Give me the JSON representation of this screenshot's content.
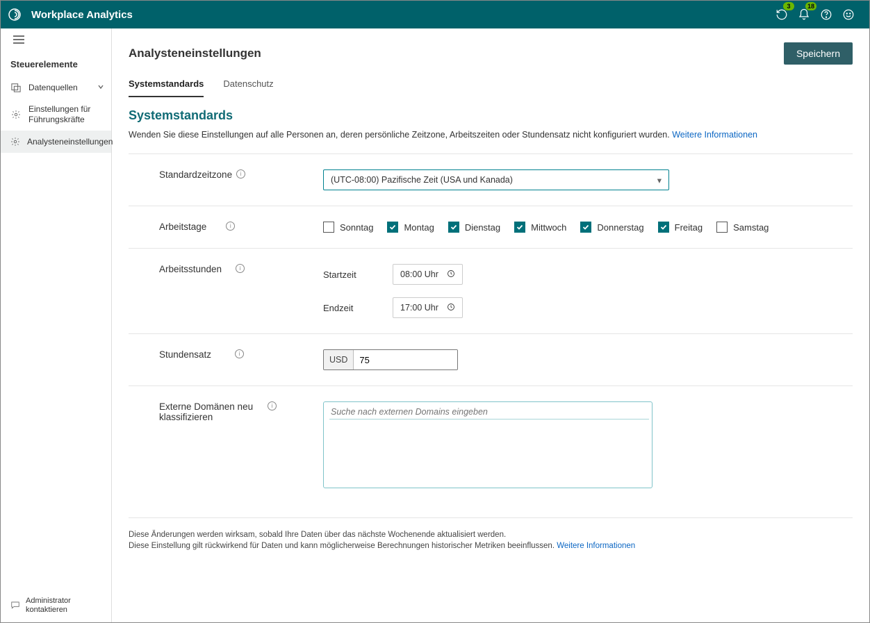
{
  "header": {
    "app_title": "Workplace Analytics",
    "badge_rewind": "3",
    "badge_bell": "18"
  },
  "sidebar": {
    "section": "Steuerelemente",
    "items": [
      {
        "label": "Datenquellen",
        "expandable": true,
        "icon": "datasource"
      },
      {
        "label": "Einstellungen für Führungskräfte",
        "icon": "gear"
      },
      {
        "label": "Analysteneinstellungen",
        "icon": "gear",
        "active": true
      }
    ],
    "footer": "Administrator kontaktieren"
  },
  "page": {
    "title": "Analysteneinstellungen",
    "save": "Speichern",
    "tabs": [
      {
        "label": "Systemstandards",
        "active": true
      },
      {
        "label": "Datenschutz"
      }
    ],
    "section_heading": "Systemstandards",
    "section_desc": "Wenden Sie diese Einstellungen auf alle Personen an, deren persönliche Zeitzone, Arbeitszeiten oder Stundensatz nicht konfiguriert wurden.",
    "more_info": "Weitere Informationen",
    "fields": {
      "timezone": {
        "label": "Standardzeitzone",
        "value": "(UTC-08:00) Pazifische Zeit (USA und Kanada)"
      },
      "workdays": {
        "label": "Arbeitstage",
        "days": [
          {
            "label": "Sonntag",
            "checked": false
          },
          {
            "label": "Montag",
            "checked": true
          },
          {
            "label": "Dienstag",
            "checked": true
          },
          {
            "label": "Mittwoch",
            "checked": true
          },
          {
            "label": "Donnerstag",
            "checked": true
          },
          {
            "label": "Freitag",
            "checked": true
          },
          {
            "label": "Samstag",
            "checked": false
          }
        ]
      },
      "workhours": {
        "label": "Arbeitsstunden",
        "start_label": "Startzeit",
        "start": "08:00 Uhr",
        "end_label": "Endzeit",
        "end": "17:00 Uhr"
      },
      "rate": {
        "label": "Stundensatz",
        "currency": "USD",
        "value": "75"
      },
      "domains": {
        "label": "Externe Domänen neu klassifizieren",
        "placeholder": "Suche nach externen Domains eingeben"
      }
    },
    "notes": [
      "Diese Änderungen werden wirksam, sobald Ihre Daten über das nächste Wochenende aktualisiert werden.",
      "Diese Einstellung gilt rückwirkend für Daten und kann möglicherweise Berechnungen historischer Metriken beeinflussen."
    ]
  }
}
